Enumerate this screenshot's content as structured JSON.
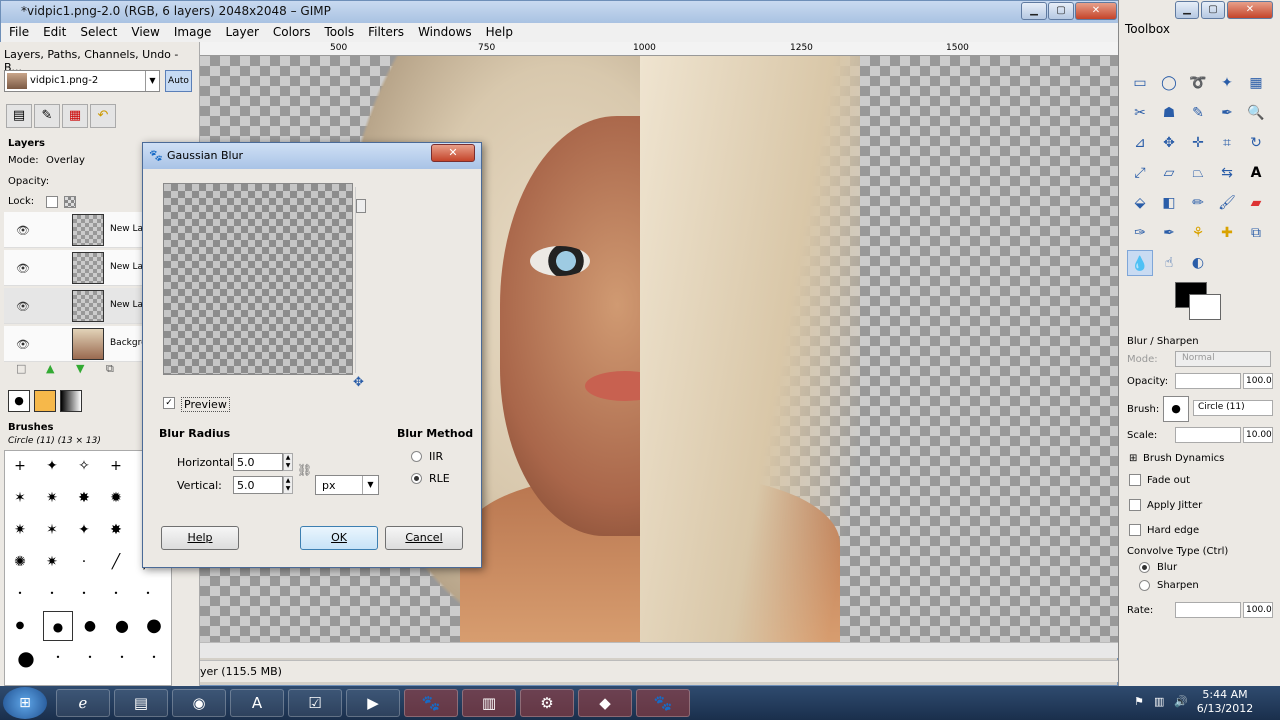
{
  "window": {
    "title": "*vidpic1.png-2.0 (RGB, 6 layers) 2048x2048 – GIMP"
  },
  "menubar": [
    "File",
    "Edit",
    "Select",
    "View",
    "Image",
    "Layer",
    "Colors",
    "Tools",
    "Filters",
    "Windows",
    "Help"
  ],
  "ruler": {
    "ticks": [
      "500",
      "750",
      "1000",
      "1250",
      "1500"
    ]
  },
  "left_dock": {
    "title": "Layers, Paths, Channels, Undo - B...",
    "image_select": "vidpic1.png-2",
    "auto_label": "Auto",
    "layers_title": "Layers",
    "mode_label": "Mode:",
    "mode_value": "Overlay",
    "opacity_label": "Opacity:",
    "lock_label": "Lock:",
    "layers": [
      {
        "name": "New La"
      },
      {
        "name": "New La"
      },
      {
        "name": "New La"
      },
      {
        "name": "Backgro"
      }
    ],
    "brushes_title": "Brushes",
    "brush_name": "Circle (11) (13 × 13)"
  },
  "status": {
    "text": "yer (115.5 MB)"
  },
  "dialog": {
    "title": "Gaussian Blur",
    "preview_label": "Preview",
    "blur_radius_title": "Blur Radius",
    "horizontal_label": "Horizontal:",
    "horizontal_value": "5.0",
    "vertical_label": "Vertical:",
    "vertical_value": "5.0",
    "unit": "px",
    "blur_method_title": "Blur Method",
    "methods": [
      "IIR",
      "RLE"
    ],
    "selected_method": "RLE",
    "help_label": "Help",
    "ok_label": "OK",
    "cancel_label": "Cancel"
  },
  "toolbox": {
    "title": "Toolbox",
    "options_title": "Blur / Sharpen",
    "mode_label": "Mode:",
    "mode_value": "Normal",
    "opacity_label": "Opacity:",
    "opacity_value": "100.0",
    "brush_label": "Brush:",
    "brush_value": "Circle (11)",
    "scale_label": "Scale:",
    "scale_value": "10.00",
    "brush_dynamics": "Brush Dynamics",
    "fade_out": "Fade out",
    "apply_jitter": "Apply Jitter",
    "hard_edge": "Hard edge",
    "convolve_label": "Convolve Type  (Ctrl)",
    "convolve_blur": "Blur",
    "convolve_sharpen": "Sharpen",
    "rate_label": "Rate:",
    "rate_value": "100.0",
    "fg_color": "#000000",
    "bg_color": "#ffffff"
  },
  "taskbar": {
    "time": "5:44 AM",
    "date": "6/13/2012"
  }
}
